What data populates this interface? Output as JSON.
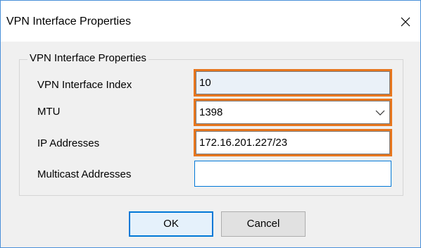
{
  "window": {
    "title": "VPN Interface Properties",
    "close_icon": "close-icon"
  },
  "group": {
    "legend": "VPN Interface Properties"
  },
  "fields": {
    "index": {
      "label": "VPN Interface Index",
      "value": "10"
    },
    "mtu": {
      "label": "MTU",
      "value": "1398",
      "arrow_icon": "chevron-down-icon"
    },
    "ip": {
      "label": "IP Addresses",
      "value": "172.16.201.227/23"
    },
    "multicast": {
      "label": "Multicast Addresses",
      "value": ""
    }
  },
  "buttons": {
    "ok": "OK",
    "cancel": "Cancel"
  },
  "colors": {
    "highlight": "#e8771e",
    "focus_border": "#0078d7",
    "window_border": "#4a90d9",
    "dialog_bg": "#f0f0f0"
  }
}
